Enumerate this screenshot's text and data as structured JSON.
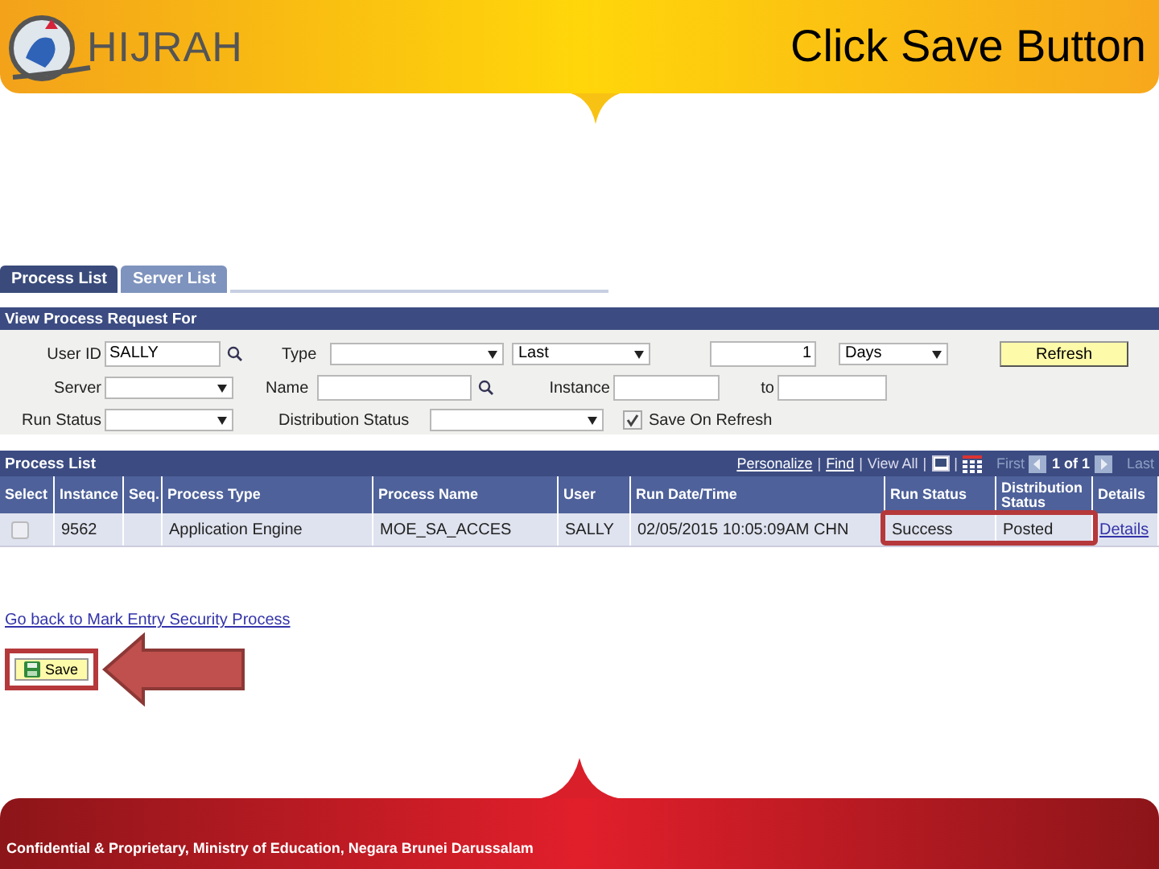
{
  "slide": {
    "logo_text": "HIJRAH",
    "title": "Click Save Button",
    "footer": "Confidential & Proprietary, Ministry of Education, Negara Brunei Darussalam"
  },
  "tabs": [
    {
      "label": "Process List",
      "selected": true
    },
    {
      "label": "Server List",
      "selected": false
    }
  ],
  "filter": {
    "title": "View Process Request For",
    "user_id": {
      "label": "User ID",
      "value": "SALLY"
    },
    "type": {
      "label": "Type"
    },
    "range": {
      "value": "Last"
    },
    "count": {
      "value": "1"
    },
    "unit": {
      "value": "Days"
    },
    "refresh": "Refresh",
    "server": {
      "label": "Server"
    },
    "name": {
      "label": "Name"
    },
    "instance": {
      "label": "Instance"
    },
    "to": {
      "label": "to"
    },
    "run_status": {
      "label": "Run Status"
    },
    "distribution_status": {
      "label": "Distribution Status"
    },
    "save_on_refresh": {
      "label": "Save On Refresh",
      "checked": true
    }
  },
  "process_list": {
    "title": "Process List",
    "nav": [
      {
        "kind": "link",
        "text": "Personalize"
      },
      {
        "kind": "sep",
        "text": "|"
      },
      {
        "kind": "link",
        "text": "Find"
      },
      {
        "kind": "sep",
        "text": "|"
      },
      {
        "kind": "text",
        "text": "View All"
      },
      {
        "kind": "sep",
        "text": "|"
      },
      {
        "kind": "window"
      },
      {
        "kind": "sep",
        "text": "|"
      },
      {
        "kind": "grid"
      },
      {
        "kind": "muted",
        "text": "First"
      },
      {
        "kind": "prev"
      },
      {
        "kind": "strong",
        "text": "1 of 1"
      },
      {
        "kind": "next"
      },
      {
        "kind": "muted",
        "text": "Last"
      }
    ],
    "columns": [
      "Select",
      "Instance",
      "Seq.",
      "Process Type",
      "Process Name",
      "User",
      "Run Date/Time",
      "Run Status",
      "Distribution Status",
      "Details"
    ],
    "rows": [
      {
        "selected": false,
        "status_highlighted": true,
        "cells": [
          {
            "kind": "checkbox"
          },
          {
            "kind": "text",
            "text": "9562"
          },
          {
            "kind": "text"
          },
          {
            "kind": "text",
            "text": "Application Engine"
          },
          {
            "kind": "text",
            "text": "MOE_SA_ACCES"
          },
          {
            "kind": "text",
            "text": "SALLY"
          },
          {
            "kind": "text",
            "text": "02/05/2015 10:05:09AM CHN"
          },
          {
            "kind": "text",
            "text": "Success"
          },
          {
            "kind": "text",
            "text": "Posted"
          },
          {
            "kind": "link",
            "text": "Details"
          }
        ]
      }
    ]
  },
  "back_link": "Go back to Mark Entry Security Process",
  "save_button": {
    "label": "Save",
    "highlighted": true
  },
  "pointer_arrow": true
}
